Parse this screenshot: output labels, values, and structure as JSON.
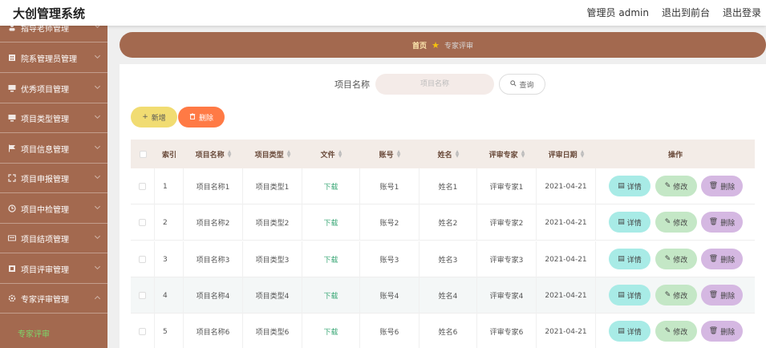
{
  "app": {
    "title": "大创管理系统"
  },
  "topnav": {
    "user": "管理员 admin",
    "front": "退出到前台",
    "logout": "退出登录"
  },
  "sidebar": {
    "items": [
      {
        "label": "指导老师管理"
      },
      {
        "label": "院系管理员管理"
      },
      {
        "label": "优秀项目管理"
      },
      {
        "label": "项目类型管理"
      },
      {
        "label": "项目信息管理"
      },
      {
        "label": "项目申报管理"
      },
      {
        "label": "项目中检管理"
      },
      {
        "label": "项目结项管理"
      },
      {
        "label": "项目评审管理"
      },
      {
        "label": "专家评审管理"
      }
    ],
    "active_sub": "专家评审"
  },
  "breadcrumb": {
    "home": "首页",
    "current": "专家评审"
  },
  "search": {
    "label": "项目名称",
    "placeholder": "项目名称",
    "button": "查询"
  },
  "actions": {
    "add": "新增",
    "delete": "删除"
  },
  "table": {
    "headers": {
      "index": "索引",
      "name": "项目名称",
      "type": "项目类型",
      "file": "文件",
      "account": "账号",
      "realname": "姓名",
      "expert": "评审专家",
      "date": "评审日期",
      "ops": "操作"
    },
    "row_buttons": {
      "detail": "详情",
      "edit": "修改",
      "remove": "删除"
    },
    "rows": [
      {
        "index": "1",
        "name": "项目名称1",
        "type": "项目类型1",
        "file": "下载",
        "account": "账号1",
        "realname": "姓名1",
        "expert": "评审专家1",
        "date": "2021-04-21"
      },
      {
        "index": "2",
        "name": "项目名称2",
        "type": "项目类型2",
        "file": "下载",
        "account": "账号2",
        "realname": "姓名2",
        "expert": "评审专家2",
        "date": "2021-04-21"
      },
      {
        "index": "3",
        "name": "项目名称3",
        "type": "项目类型3",
        "file": "下载",
        "account": "账号3",
        "realname": "姓名3",
        "expert": "评审专家3",
        "date": "2021-04-21"
      },
      {
        "index": "4",
        "name": "项目名称4",
        "type": "项目类型4",
        "file": "下载",
        "account": "账号4",
        "realname": "姓名4",
        "expert": "评审专家4",
        "date": "2021-04-21"
      },
      {
        "index": "5",
        "name": "项目名称6",
        "type": "项目类型6",
        "file": "下载",
        "account": "账号6",
        "realname": "姓名6",
        "expert": "评审专家6",
        "date": "2021-04-21"
      }
    ]
  },
  "colors": {
    "brand": "#a3694f",
    "accent_green": "#7cd86a"
  }
}
